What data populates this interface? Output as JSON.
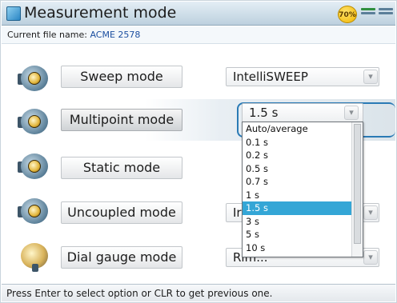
{
  "window": {
    "title": "Measurement mode",
    "battery_label": "70%",
    "icons": [
      "app-icon",
      "battery-icon",
      "status-icon",
      "network-icon"
    ]
  },
  "file": {
    "label": "Current file name:",
    "name": "ACME 2578"
  },
  "modes": [
    {
      "label": "Sweep mode",
      "icon": "sensor-icon",
      "selected": false,
      "value": "IntelliSWEEP"
    },
    {
      "label": "Multipoint mode",
      "icon": "sensor-icon",
      "selected": true,
      "value": "1.5 s"
    },
    {
      "label": "Static mode",
      "icon": "sensor-icon",
      "selected": false,
      "value": ""
    },
    {
      "label": "Uncoupled mode",
      "icon": "sensor-icon",
      "selected": false,
      "value": "Ir"
    },
    {
      "label": "Dial gauge mode",
      "icon": "dial-gauge-icon",
      "selected": false,
      "value": "Rim..."
    }
  ],
  "dropdown": {
    "options": [
      "Auto/average",
      "0.1 s",
      "0.2 s",
      "0.5 s",
      "0.7 s",
      "1 s",
      "1.5 s",
      "3 s",
      "5 s",
      "10 s"
    ],
    "selected": "1.5 s"
  },
  "status": {
    "text": "Press Enter to select option or CLR to get previous one."
  },
  "colors": {
    "highlight": "#34a6d6",
    "focus_ring": "#2a7ab5",
    "battery": "#f0b400"
  }
}
